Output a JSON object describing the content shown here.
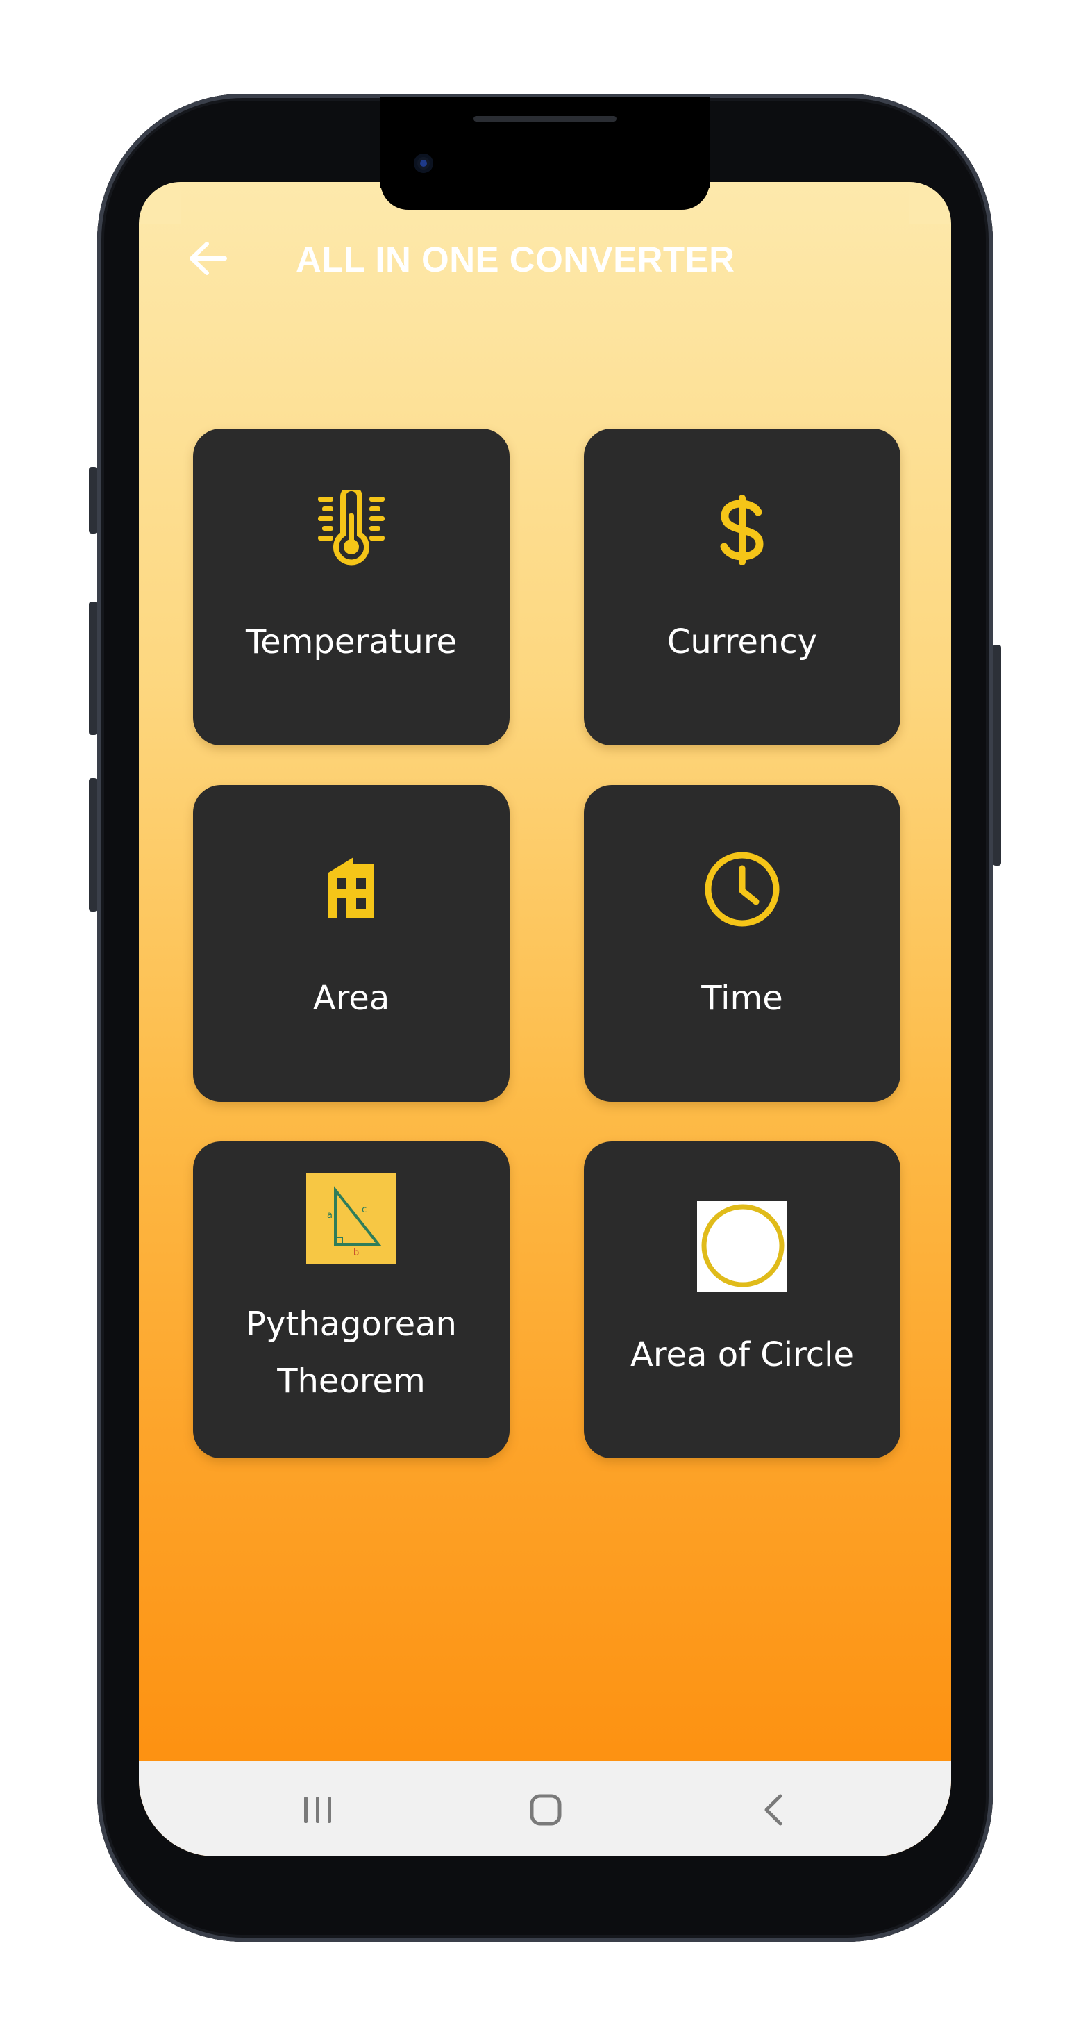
{
  "app_bar": {
    "title": "ALL IN ONE CONVERTER",
    "back_icon": "arrow-left-icon"
  },
  "cards": [
    {
      "label": "Temperature",
      "icon": "thermometer-icon"
    },
    {
      "label": "Currency",
      "icon": "dollar-icon"
    },
    {
      "label": "Area",
      "icon": "building-icon"
    },
    {
      "label": "Time",
      "icon": "clock-icon"
    },
    {
      "label_line1": "Pythagorean",
      "label_line2": "Theorem",
      "icon": "right-triangle-image"
    },
    {
      "label": "Area of Circle",
      "icon": "circle-image"
    }
  ],
  "pythagoras_image": {
    "a": "a",
    "b": "b",
    "c": "c"
  },
  "nav_bar": {
    "recents_icon": "recents-icon",
    "home_icon": "home-icon",
    "back_icon": "back-chevron-icon"
  },
  "colors": {
    "accent": "#f5c518",
    "card_bg": "#2b2b2b",
    "gradient_top": "#fde9ac",
    "gradient_bottom": "#fd8c0a",
    "nav_bg": "#f1f1f1"
  }
}
